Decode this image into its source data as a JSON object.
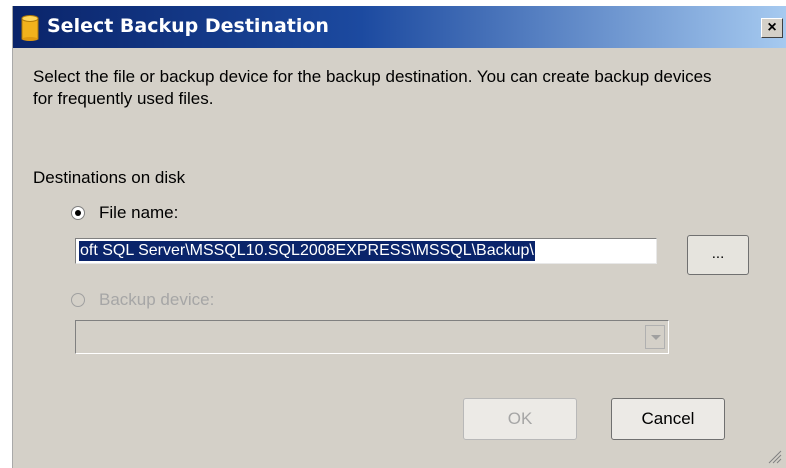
{
  "dialog": {
    "title": "Select Backup Destination",
    "close_label": "×",
    "description": "Select the file or backup device for the backup destination. You can create backup devices for frequently used files.",
    "group_label": "Destinations on disk",
    "file_name_option": {
      "label": "File name:",
      "checked": true
    },
    "file_path_value": "oft SQL Server\\MSSQL10.SQL2008EXPRESS\\MSSQL\\Backup\\",
    "browse_label": "...",
    "backup_device_option": {
      "label": "Backup device:",
      "checked": false,
      "enabled": false
    },
    "backup_device_value": "",
    "ok_label": "OK",
    "ok_enabled": false,
    "cancel_label": "Cancel"
  },
  "icons": [
    "database-icon",
    "close-icon",
    "chevron-down-icon",
    "resize-grip-icon"
  ],
  "colors": {
    "titlebar_start": "#0a246a",
    "titlebar_end": "#a6caf0",
    "dialog_bg": "#d4d0c8",
    "selection": "#0a246a"
  }
}
